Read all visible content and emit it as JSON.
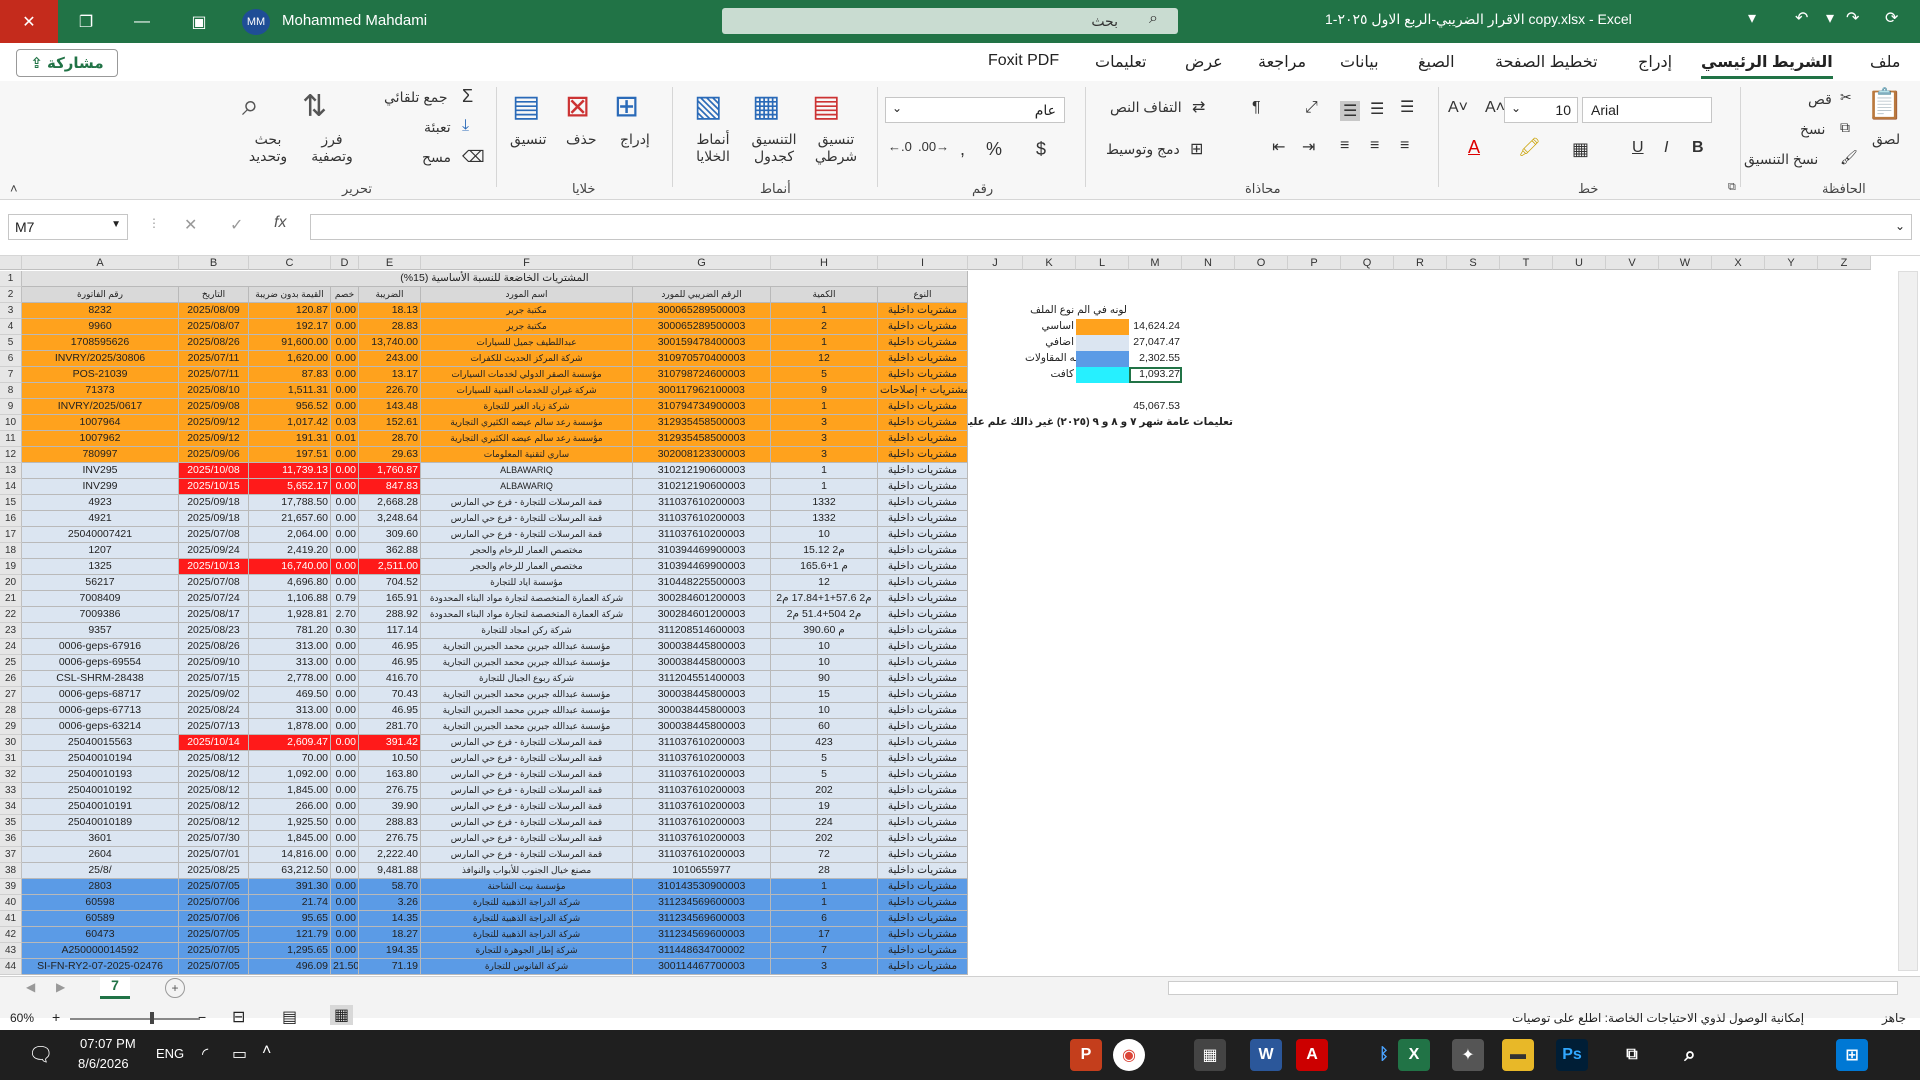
{
  "window": {
    "title": "الاقرار الضريبي-الربع الاول ٢٠٢٥-1 copy.xlsx  -  Excel",
    "user_initials": "MM",
    "user_name": "Mohammed Mahdami",
    "search_placeholder": "بحث"
  },
  "menu": {
    "share": "مشاركة",
    "items": [
      "ملف",
      "الشريط الرئيسي",
      "إدراج",
      "تخطيط الصفحة",
      "الصيغ",
      "بيانات",
      "مراجعة",
      "عرض",
      "تعليمات",
      "Foxit PDF"
    ]
  },
  "ribbon": {
    "clipboard": {
      "paste": "لصق",
      "cut": "قص",
      "copy": "نسخ",
      "format_painter": "نسخ التنسيق",
      "group": "الحافظة"
    },
    "font": {
      "name": "Arial",
      "size": "10",
      "group": "خط",
      "bold": "B",
      "italic": "I",
      "underline": "U"
    },
    "alignment": {
      "wrap": "التفاف النص",
      "merge": "دمج وتوسيط",
      "group": "محاذاة"
    },
    "number": {
      "format": "عام",
      "group": "رقم"
    },
    "styles": {
      "conditional": "تنسيق شرطي",
      "table": "التنسيق كجدول",
      "cell_styles": "أنماط الخلايا",
      "group": "أنماط"
    },
    "cells": {
      "insert": "إدراج",
      "delete": "حذف",
      "format": "تنسيق",
      "group": "خلايا"
    },
    "editing": {
      "autosum": "جمع تلقائي",
      "fill": "تعبئة",
      "clear": "مسح",
      "sort": "فرز وتصفية",
      "find": "بحث وتحديد",
      "group": "تحرير"
    }
  },
  "formula": {
    "namebox": "M7",
    "fx": "fx",
    "value": ""
  },
  "sheet": {
    "columns": [
      "A",
      "B",
      "C",
      "D",
      "E",
      "F",
      "G",
      "H",
      "I",
      "J",
      "K",
      "L",
      "M",
      "N",
      "O",
      "P",
      "Q",
      "R",
      "S",
      "T",
      "U",
      "V",
      "W",
      "X",
      "Y",
      "Z"
    ],
    "banner": "المشتريات الخاضعة للنسبة الأساسية (15%)",
    "headers": [
      "رقم الفاتورة",
      "التاريخ",
      "القيمة بدون ضريبة",
      "خصم",
      "الضريبة",
      "اسم المورد",
      "الرقم الضريبي للمورد",
      "الكمية",
      "النوع"
    ],
    "rows": [
      {
        "n": "3",
        "a": "8232",
        "b": "2025/08/09",
        "c": "120.87",
        "d": "0.00",
        "e": "18.13",
        "f": "مكتبة جرير",
        "g": "300065289500003",
        "h": "1",
        "i": "مشتريات داخلية",
        "color": "orange"
      },
      {
        "n": "4",
        "a": "9960",
        "b": "2025/08/07",
        "c": "192.17",
        "d": "0.00",
        "e": "28.83",
        "f": "مكتبة جرير",
        "g": "300065289500003",
        "h": "2",
        "i": "مشتريات داخلية",
        "color": "orange"
      },
      {
        "n": "5",
        "a": "1708595626",
        "b": "2025/08/26",
        "c": "91,600.00",
        "d": "0.00",
        "e": "13,740.00",
        "f": "عبداللطيف جميل للسيارات",
        "g": "300159478400003",
        "h": "1",
        "i": "مشتريات داخلية",
        "color": "orange"
      },
      {
        "n": "6",
        "a": "INVRY/2025/30806",
        "b": "2025/07/11",
        "c": "1,620.00",
        "d": "0.00",
        "e": "243.00",
        "f": "شركة المركز الحديث للكفرات",
        "g": "310970570400003",
        "h": "12",
        "i": "مشتريات داخلية",
        "color": "orange"
      },
      {
        "n": "7",
        "a": "POS-21039",
        "b": "2025/07/11",
        "c": "87.83",
        "d": "0.00",
        "e": "13.17",
        "f": "مؤسسة الصقر الدولي لخدمات السيارات",
        "g": "310798724600003",
        "h": "5",
        "i": "مشتريات داخلية",
        "color": "orange"
      },
      {
        "n": "8",
        "a": "71373",
        "b": "2025/08/10",
        "c": "1,511.31",
        "d": "0.00",
        "e": "226.70",
        "f": "شركة غيران للخدمات الفنية للسيارات",
        "g": "300117962100003",
        "h": "9",
        "i": "مشتريات + إصلاحات",
        "color": "orange"
      },
      {
        "n": "9",
        "a": "INVRY/2025/0617",
        "b": "2025/09/08",
        "c": "956.52",
        "d": "0.00",
        "e": "143.48",
        "f": "شركة زياد الغير للتجارة",
        "g": "310794734900003",
        "h": "1",
        "i": "مشتريات داخلية",
        "color": "orange"
      },
      {
        "n": "10",
        "a": "1007964",
        "b": "2025/09/12",
        "c": "1,017.42",
        "d": "0.03",
        "e": "152.61",
        "f": "مؤسسة رعد سالم عيضه الكثيري التجارية",
        "g": "312935458500003",
        "h": "3",
        "i": "مشتريات داخلية",
        "color": "orange"
      },
      {
        "n": "11",
        "a": "1007962",
        "b": "2025/09/12",
        "c": "191.31",
        "d": "0.01",
        "e": "28.70",
        "f": "مؤسسة رعد سالم عيضه الكثيري التجارية",
        "g": "312935458500003",
        "h": "3",
        "i": "مشتريات داخلية",
        "color": "orange"
      },
      {
        "n": "12",
        "a": "780997",
        "b": "2025/09/06",
        "c": "197.51",
        "d": "0.00",
        "e": "29.63",
        "f": "ساري لتقنية المعلومات",
        "g": "302008123300003",
        "h": "3",
        "i": "مشتريات داخلية",
        "color": "orange"
      },
      {
        "n": "13",
        "a": "INV295",
        "b": "2025/10/08",
        "c": "11,739.13",
        "d": "0.00",
        "e": "1,760.87",
        "f": "ALBAWARIQ",
        "g": "310212190600003",
        "h": "1",
        "i": "مشتريات داخلية",
        "color": "lblue",
        "redbe": true
      },
      {
        "n": "14",
        "a": "INV299",
        "b": "2025/10/15",
        "c": "5,652.17",
        "d": "0.00",
        "e": "847.83",
        "f": "ALBAWARIQ",
        "g": "310212190600003",
        "h": "1",
        "i": "مشتريات داخلية",
        "color": "lblue",
        "redbe": true
      },
      {
        "n": "15",
        "a": "4923",
        "b": "2025/09/18",
        "c": "17,788.50",
        "d": "0.00",
        "e": "2,668.28",
        "f": "قمة المرسلات للتجارة - فرع حي المارس",
        "g": "311037610200003",
        "h": "1332",
        "i": "مشتريات داخلية",
        "color": "lblue"
      },
      {
        "n": "16",
        "a": "4921",
        "b": "2025/09/18",
        "c": "21,657.60",
        "d": "0.00",
        "e": "3,248.64",
        "f": "قمة المرسلات للتجارة - فرع حي المارس",
        "g": "311037610200003",
        "h": "1332",
        "i": "مشتريات داخلية",
        "color": "lblue"
      },
      {
        "n": "17",
        "a": "25040007421",
        "b": "2025/07/08",
        "c": "2,064.00",
        "d": "0.00",
        "e": "309.60",
        "f": "قمة المرسلات للتجارة - فرع حي المارس",
        "g": "311037610200003",
        "h": "10",
        "i": "مشتريات داخلية",
        "color": "lblue"
      },
      {
        "n": "18",
        "a": "1207",
        "b": "2025/09/24",
        "c": "2,419.20",
        "d": "0.00",
        "e": "362.88",
        "f": "مختصص العمار للرخام والحجر",
        "g": "310394469900003",
        "h": "15.12 م2",
        "i": "مشتريات داخلية",
        "color": "lblue"
      },
      {
        "n": "19",
        "a": "1325",
        "b": "2025/10/13",
        "c": "16,740.00",
        "d": "0.00",
        "e": "2,511.00",
        "f": "مختصص العمار للرخام والحجر",
        "g": "310394469900003",
        "h": "165.6+1 م",
        "i": "مشتريات داخلية",
        "color": "lblue",
        "redbe": true
      },
      {
        "n": "20",
        "a": "56217",
        "b": "2025/07/08",
        "c": "4,696.80",
        "d": "0.00",
        "e": "704.52",
        "f": "مؤسسة اياد للتجارة",
        "g": "310448225500003",
        "h": "12",
        "i": "مشتريات داخلية",
        "color": "lblue"
      },
      {
        "n": "21",
        "a": "7008409",
        "b": "2025/07/24",
        "c": "1,106.88",
        "d": "0.79",
        "e": "165.91",
        "f": "شركة العمارة المتخصصة لتجارة مواد البناء المحدودة",
        "g": "300284601200003",
        "h": "م2 57.6+1+17.84 م2",
        "i": "مشتريات داخلية",
        "color": "lblue"
      },
      {
        "n": "22",
        "a": "7009386",
        "b": "2025/08/17",
        "c": "1,928.81",
        "d": "2.70",
        "e": "288.92",
        "f": "شركة العمارة المتخصصة لتجارة مواد البناء المحدودة",
        "g": "300284601200003",
        "h": "م2 504+51.4 م2",
        "i": "مشتريات داخلية",
        "color": "lblue"
      },
      {
        "n": "23",
        "a": "9357",
        "b": "2025/08/23",
        "c": "781.20",
        "d": "0.30",
        "e": "117.14",
        "f": "شركة ركن امجاد للتجارة",
        "g": "311208514600003",
        "h": "390.60 م",
        "i": "مشتريات داخلية",
        "color": "lblue"
      },
      {
        "n": "24",
        "a": "0006-geps-67916",
        "b": "2025/08/26",
        "c": "313.00",
        "d": "0.00",
        "e": "46.95",
        "f": "مؤسسة عبدالله جبرين محمد الجبرين التجارية",
        "g": "300038445800003",
        "h": "10",
        "i": "مشتريات داخلية",
        "color": "lblue"
      },
      {
        "n": "25",
        "a": "0006-geps-69554",
        "b": "2025/09/10",
        "c": "313.00",
        "d": "0.00",
        "e": "46.95",
        "f": "مؤسسة عبدالله جبرين محمد الجبرين التجارية",
        "g": "300038445800003",
        "h": "10",
        "i": "مشتريات داخلية",
        "color": "lblue"
      },
      {
        "n": "26",
        "a": "CSL-SHRM-28438",
        "b": "2025/07/15",
        "c": "2,778.00",
        "d": "0.00",
        "e": "416.70",
        "f": "شركة ربوع الجبال للتجارة",
        "g": "311204551400003",
        "h": "90",
        "i": "مشتريات داخلية",
        "color": "lblue"
      },
      {
        "n": "27",
        "a": "0006-geps-68717",
        "b": "2025/09/02",
        "c": "469.50",
        "d": "0.00",
        "e": "70.43",
        "f": "مؤسسة عبدالله جبرين محمد الجبرين التجارية",
        "g": "300038445800003",
        "h": "15",
        "i": "مشتريات داخلية",
        "color": "lblue"
      },
      {
        "n": "28",
        "a": "0006-geps-67713",
        "b": "2025/08/24",
        "c": "313.00",
        "d": "0.00",
        "e": "46.95",
        "f": "مؤسسة عبدالله جبرين محمد الجبرين التجارية",
        "g": "300038445800003",
        "h": "10",
        "i": "مشتريات داخلية",
        "color": "lblue"
      },
      {
        "n": "29",
        "a": "0006-geps-63214",
        "b": "2025/07/13",
        "c": "1,878.00",
        "d": "0.00",
        "e": "281.70",
        "f": "مؤسسة عبدالله جبرين محمد الجبرين التجارية",
        "g": "300038445800003",
        "h": "60",
        "i": "مشتريات داخلية",
        "color": "lblue"
      },
      {
        "n": "30",
        "a": "25040015563",
        "b": "2025/10/14",
        "c": "2,609.47",
        "d": "0.00",
        "e": "391.42",
        "f": "قمة المرسلات للتجارة - فرع حي المارس",
        "g": "311037610200003",
        "h": "423",
        "i": "مشتريات داخلية",
        "color": "lblue",
        "redbe": true
      },
      {
        "n": "31",
        "a": "25040010194",
        "b": "2025/08/12",
        "c": "70.00",
        "d": "0.00",
        "e": "10.50",
        "f": "قمة المرسلات للتجارة - فرع حي المارس",
        "g": "311037610200003",
        "h": "5",
        "i": "مشتريات داخلية",
        "color": "lblue"
      },
      {
        "n": "32",
        "a": "25040010193",
        "b": "2025/08/12",
        "c": "1,092.00",
        "d": "0.00",
        "e": "163.80",
        "f": "قمة المرسلات للتجارة - فرع حي المارس",
        "g": "311037610200003",
        "h": "5",
        "i": "مشتريات داخلية",
        "color": "lblue"
      },
      {
        "n": "33",
        "a": "25040010192",
        "b": "2025/08/12",
        "c": "1,845.00",
        "d": "0.00",
        "e": "276.75",
        "f": "قمة المرسلات للتجارة - فرع حي المارس",
        "g": "311037610200003",
        "h": "202",
        "i": "مشتريات داخلية",
        "color": "lblue"
      },
      {
        "n": "34",
        "a": "25040010191",
        "b": "2025/08/12",
        "c": "266.00",
        "d": "0.00",
        "e": "39.90",
        "f": "قمة المرسلات للتجارة - فرع حي المارس",
        "g": "311037610200003",
        "h": "19",
        "i": "مشتريات داخلية",
        "color": "lblue"
      },
      {
        "n": "35",
        "a": "25040010189",
        "b": "2025/08/12",
        "c": "1,925.50",
        "d": "0.00",
        "e": "288.83",
        "f": "قمة المرسلات للتجارة - فرع حي المارس",
        "g": "311037610200003",
        "h": "224",
        "i": "مشتريات داخلية",
        "color": "lblue"
      },
      {
        "n": "36",
        "a": "3601",
        "b": "2025/07/30",
        "c": "1,845.00",
        "d": "0.00",
        "e": "276.75",
        "f": "قمة المرسلات للتجارة - فرع حي المارس",
        "g": "311037610200003",
        "h": "202",
        "i": "مشتريات داخلية",
        "color": "lblue"
      },
      {
        "n": "37",
        "a": "2604",
        "b": "2025/07/01",
        "c": "14,816.00",
        "d": "0.00",
        "e": "2,222.40",
        "f": "قمة المرسلات للتجارة - فرع حي المارس",
        "g": "311037610200003",
        "h": "72",
        "i": "مشتريات داخلية",
        "color": "lblue"
      },
      {
        "n": "38",
        "a": "25/8/",
        "b": "2025/08/25",
        "c": "63,212.50",
        "d": "0.00",
        "e": "9,481.88",
        "f": "مصنع خيال الجنوب للأبواب والنوافذ",
        "g": "1010655977",
        "h": "28",
        "i": "مشتريات داخلية",
        "color": "lblue"
      },
      {
        "n": "39",
        "a": "2803",
        "b": "2025/07/05",
        "c": "391.30",
        "d": "0.00",
        "e": "58.70",
        "f": "مؤسسة بيت الشاحنة",
        "g": "310143530900003",
        "h": "1",
        "i": "مشتريات داخلية",
        "color": "blue"
      },
      {
        "n": "40",
        "a": "60598",
        "b": "2025/07/06",
        "c": "21.74",
        "d": "0.00",
        "e": "3.26",
        "f": "شركة الدراجة الذهبية للتجارة",
        "g": "311234569600003",
        "h": "1",
        "i": "مشتريات داخلية",
        "color": "blue"
      },
      {
        "n": "41",
        "a": "60589",
        "b": "2025/07/06",
        "c": "95.65",
        "d": "0.00",
        "e": "14.35",
        "f": "شركة الدراجة الذهبية للتجارة",
        "g": "311234569600003",
        "h": "6",
        "i": "مشتريات داخلية",
        "color": "blue"
      },
      {
        "n": "42",
        "a": "60473",
        "b": "2025/07/05",
        "c": "121.79",
        "d": "0.00",
        "e": "18.27",
        "f": "شركة الدراجة الذهبية للتجارة",
        "g": "311234569600003",
        "h": "17",
        "i": "مشتريات داخلية",
        "color": "blue"
      },
      {
        "n": "43",
        "a": "A250000014592",
        "b": "2025/07/05",
        "c": "1,295.65",
        "d": "0.00",
        "e": "194.35",
        "f": "شركة إطار الجوهرة للتجارة",
        "g": "311448634700002",
        "h": "7",
        "i": "مشتريات داخلية",
        "color": "blue"
      },
      {
        "n": "44",
        "a": "SI-FN-RY2-07-2025-02476",
        "b": "2025/07/05",
        "c": "496.09",
        "d": "21.50",
        "e": "71.19",
        "f": "شركة الفانوس للتجارة",
        "g": "300114467700003",
        "h": "3",
        "i": "مشتريات داخلية",
        "color": "blue"
      }
    ],
    "legend": {
      "title": "لونه في الم نوع الملف",
      "items": [
        {
          "label": "اساسي",
          "value": "14,624.24",
          "color": "orange"
        },
        {
          "label": "اضافي",
          "value": "27,047.47",
          "color": "lblue"
        },
        {
          "label": "عبدالله المقاولات",
          "value": "2,302.55",
          "color": "blue"
        },
        {
          "label": "كافت",
          "value": "1,093.27",
          "color": "cyan"
        }
      ],
      "total": "45,067.53",
      "note": "تعليمات عامة   شهر ٧ و ٨ و ٩ (٢٠٢٥) غير ذالك علم عليه بي اللون الاحمر"
    }
  },
  "tabs": {
    "active": "7",
    "add": "+"
  },
  "status": {
    "zoom": "60%",
    "ready": "جاهز",
    "accessibility": "إمكانية الوصول لذوي الاحتياجات الخاصة: اطلع على توصيات"
  },
  "taskbar": {
    "time": "07:07 PM",
    "date": "8/6/2026",
    "lang": "ENG"
  }
}
